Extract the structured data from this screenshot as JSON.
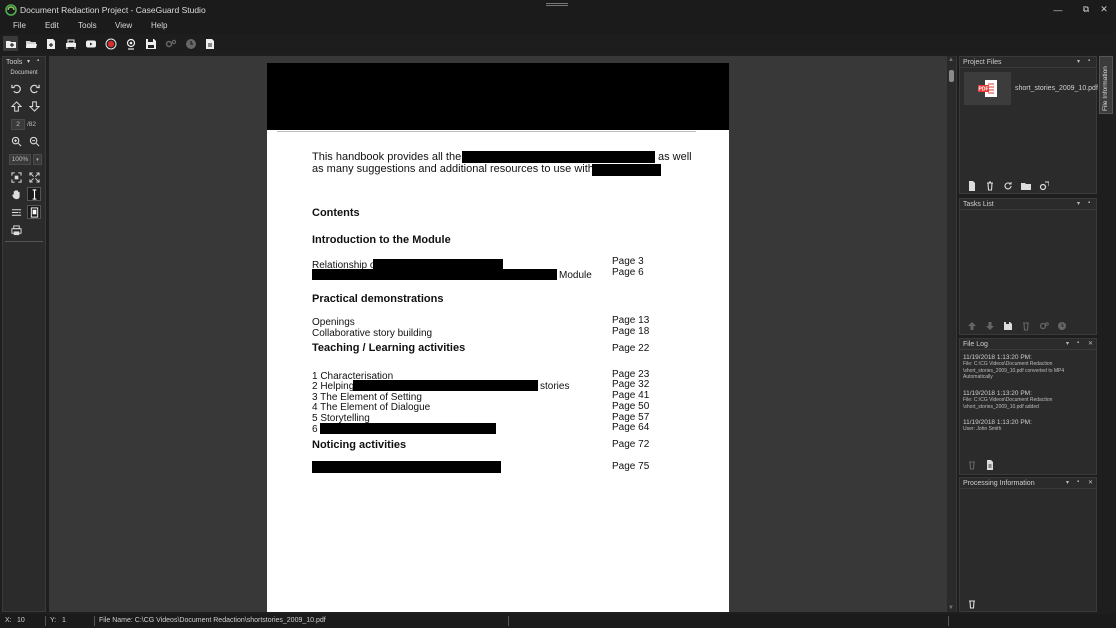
{
  "window": {
    "title": "Document Redaction Project - CaseGuard Studio",
    "controls": [
      "—",
      "⧉",
      "✕"
    ]
  },
  "menu": [
    "File",
    "Edit",
    "Tools",
    "View",
    "Help"
  ],
  "tools_panel": {
    "title": "Tools",
    "section": "Document",
    "page_current": "2",
    "page_total": "/82",
    "zoom": "100%"
  },
  "document": {
    "intro_line1_a": "This handbook provides all the",
    "intro_line1_b": "as well",
    "intro_line2": "as many suggestions and additional resources to use with",
    "contents_heading": "Contents",
    "sections": [
      {
        "heading": "Introduction to the Module",
        "items": [
          {
            "text": "Relationship o",
            "page": "Page 3"
          },
          {
            "text": "Module",
            "page": "Page 6"
          }
        ]
      },
      {
        "heading": "Practical demonstrations",
        "items": [
          {
            "text": "Openings",
            "page": "Page 13"
          },
          {
            "text": "Collaborative story building",
            "page": "Page 18"
          }
        ]
      },
      {
        "heading": "Teaching / Learning activities",
        "heading_page": "Page 22",
        "items": [
          {
            "text": "1 Characterisation",
            "page": "Page 23"
          },
          {
            "text": "2 Helping",
            "suffix": "stories",
            "page": "Page 32"
          },
          {
            "text": "3 The Element of Setting",
            "page": "Page 41"
          },
          {
            "text": "4 The Element of Dialogue",
            "page": "Page 50"
          },
          {
            "text": "5 Storytelling",
            "page": "Page 57"
          },
          {
            "text": "6",
            "page": "Page 64"
          }
        ]
      },
      {
        "heading": "Noticing activities",
        "heading_page": "Page 72",
        "items": [
          {
            "text": "",
            "page": "Page 75"
          }
        ]
      }
    ]
  },
  "project_files": {
    "title": "Project Files",
    "file_name": "short_stories_2009_10.pdf",
    "thumb_label": "PDF"
  },
  "tasks_list": {
    "title": "Tasks List"
  },
  "file_log": {
    "title": "File Log",
    "entries": [
      {
        "time": "11/19/2018 1:13:20 PM:",
        "lines": [
          "File: C:\\CG Videos\\Document Redaction",
          "\\short_stories_2009_10.pdf converted to MP4",
          "Automatically"
        ]
      },
      {
        "time": "11/19/2018 1:13:20 PM:",
        "lines": [
          "File: C:\\CG Videos\\Document Redaction",
          "\\short_stories_2009_10.pdf added"
        ]
      },
      {
        "time": "11/19/2018 1:13:20 PM:",
        "lines": [
          "User: John Smith"
        ]
      }
    ]
  },
  "processing": {
    "title": "Processing Information"
  },
  "side_tab": "File Information",
  "status": {
    "x_label": "X:",
    "x_value": "10",
    "y_label": "Y:",
    "y_value": "1",
    "file_name": "File Name: C:\\CG Videos\\Document Redaction\\shortstories_2009_10.pdf"
  },
  "colors": {
    "background": "#1e1e1e",
    "panel": "#2b2b2b",
    "viewer": "#383838",
    "record_red": "#d32f2f",
    "pdf_red": "#e53935"
  }
}
